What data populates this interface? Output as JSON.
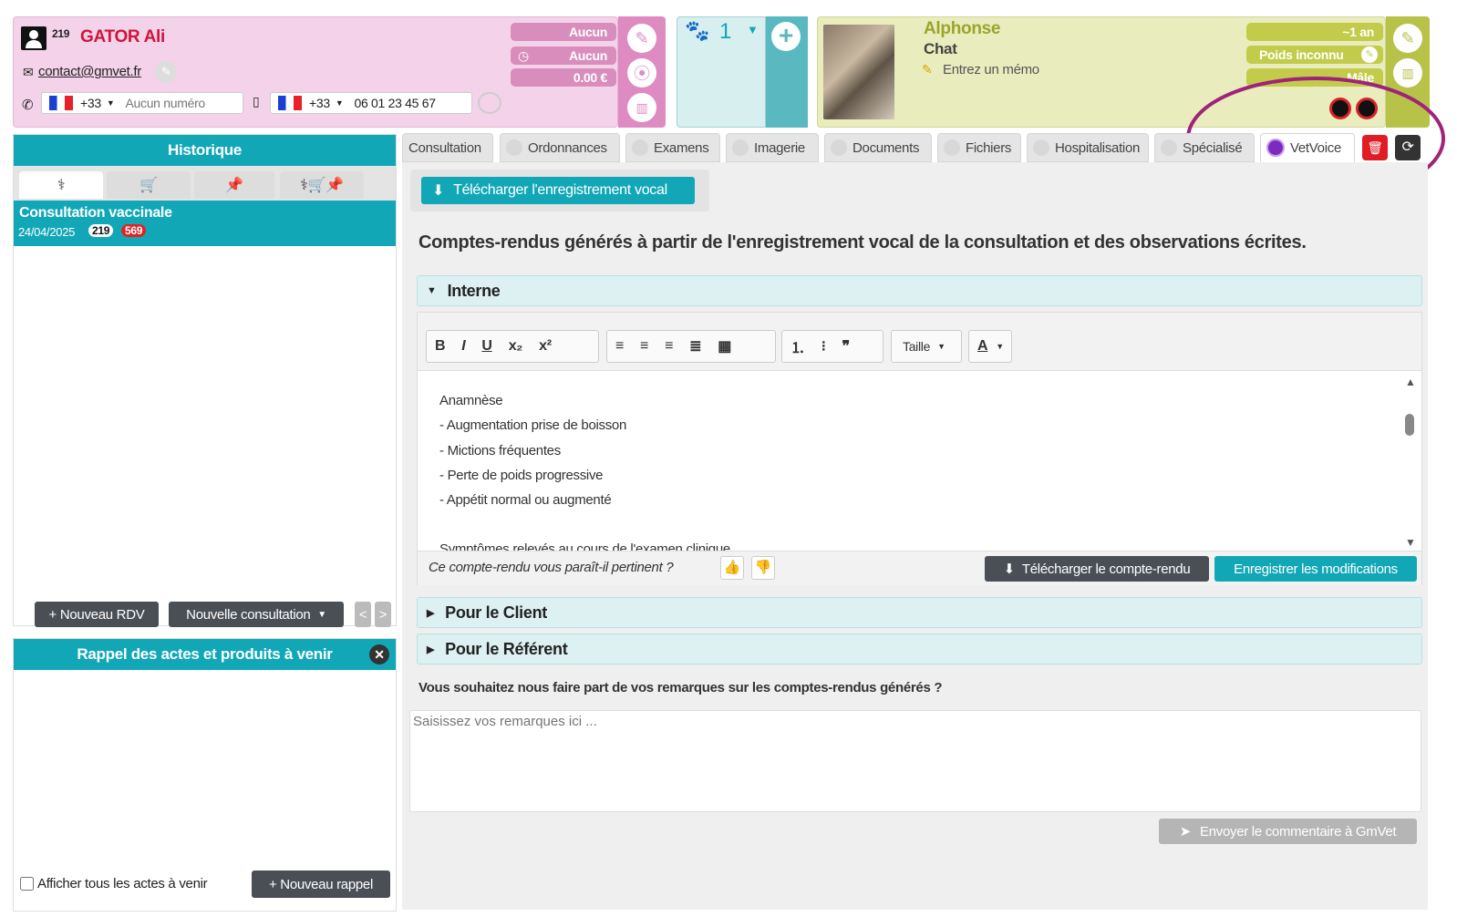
{
  "owner": {
    "id": "219",
    "name": "GATOR Ali",
    "email": "contact@gmvet.fr",
    "phone1_code": "+33",
    "phone1_placeholder": "Aucun numéro",
    "phone2_code": "+33",
    "phone2_value": "06 01 23 45 67",
    "badge1": "Aucun",
    "badge2": "Aucun",
    "balance": "0.00 €"
  },
  "animals": {
    "count": "1"
  },
  "pet": {
    "name": "Alphonse",
    "species": "Chat",
    "memo_placeholder": "Entrez un mémo",
    "age": "~1 an",
    "weight": "Poids inconnu",
    "sex": "Mâle"
  },
  "history": {
    "title": "Historique",
    "entry_title": "Consultation vaccinale",
    "entry_date": "24/04/2025",
    "entry_badge1": "219",
    "entry_badge2": "569",
    "btn_new_rdv": "Nouveau RDV",
    "btn_new_consult": "Nouvelle consultation"
  },
  "reminders": {
    "title": "Rappel des actes et produits à venir",
    "show_all": "Afficher tous les actes à venir",
    "btn_new": "Nouveau rappel"
  },
  "tabs": [
    {
      "label": "Consultation"
    },
    {
      "label": "Ordonnances"
    },
    {
      "label": "Examens"
    },
    {
      "label": "Imagerie"
    },
    {
      "label": "Documents"
    },
    {
      "label": "Fichiers"
    },
    {
      "label": "Hospitalisation"
    },
    {
      "label": "Spécialisé"
    },
    {
      "label": "VetVoice"
    }
  ],
  "main": {
    "download_audio": "Télécharger l'enregistrement vocal",
    "heading": "Comptes-rendus générés à partir de l'enregistrement vocal de la consultation et des observations écrites.",
    "section_internal": "Interne",
    "size_label": "Taille",
    "editor_lines": [
      "Anamnèse",
      "- Augmentation prise de boisson",
      "- Mictions fréquentes",
      "- Perte de poids progressive",
      "- Appétit normal ou augmenté",
      "",
      "Symptômes relevés au cours de l'examen clinique"
    ],
    "feedback_question": "Ce compte-rendu vous paraît-il pertinent ?",
    "btn_download_report": "Télécharger le compte-rendu",
    "btn_save": "Enregistrer les modifications",
    "section_client": "Pour le Client",
    "section_referent": "Pour le Référent",
    "remarks_question": "Vous souhaitez nous faire part de vos remarques sur les comptes-rendus générés ?",
    "remarks_placeholder": "Saisissez vos remarques ici ...",
    "btn_send": "Envoyer le commentaire à GmVet"
  },
  "colors": {
    "teal": "#12a7b7",
    "pink": "#f4d3ea",
    "green": "#e9edbd",
    "highlight": "#a0237a"
  }
}
